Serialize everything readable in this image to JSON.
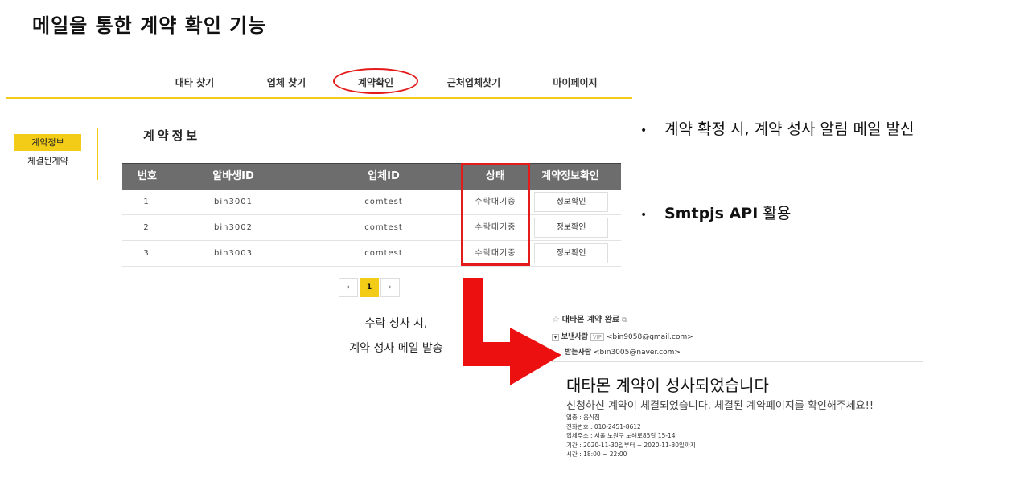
{
  "slide_title": "메일을 통한 계약 확인 기능",
  "nav": [
    {
      "label": "대타 찾기"
    },
    {
      "label": "업체 찾기"
    },
    {
      "label": "계약확인"
    },
    {
      "label": "근처업체찾기"
    },
    {
      "label": "마이페이지"
    }
  ],
  "sidebar": {
    "active": "계약정보",
    "item": "체결된계약"
  },
  "section_title": "계약정보",
  "table": {
    "headers": [
      "번호",
      "알바생ID",
      "업체ID",
      "상태",
      "계약정보확인"
    ],
    "rows": [
      {
        "no": "1",
        "worker": "bin3001",
        "company": "comtest",
        "status": "수락대기중",
        "action": "정보확인"
      },
      {
        "no": "2",
        "worker": "bin3002",
        "company": "comtest",
        "status": "수락대기중",
        "action": "정보확인"
      },
      {
        "no": "3",
        "worker": "bin3003",
        "company": "comtest",
        "status": "수락대기중",
        "action": "정보확인"
      }
    ]
  },
  "pagination": {
    "prev": "‹",
    "current": "1",
    "next": "›"
  },
  "bullets": [
    {
      "text": "계약 확정 시, 계약 성사 알림 메일 발신"
    },
    {
      "strong": "Smtpjs API",
      "rest": " 활용"
    }
  ],
  "bullet_marker": "•",
  "caption": [
    "수락 성사 시,",
    "계약 성사 메일 발송"
  ],
  "email": {
    "star": "☆",
    "subject": "대타몬 계약 완료",
    "sender_label": "보낸사람",
    "sender_badge": "VIP",
    "sender": "<bin9058@gmail.com>",
    "receiver_label": "받는사람",
    "receiver": "<bin3005@naver.com>",
    "title": "대타몬 계약이 성사되었습니다",
    "body": "신청하신 계약이 체결되었습니다. 체결된 계약페이지를 확인해주세요!!",
    "details": [
      "업종 : 음식점",
      "전화번호 : 010-2451-8612",
      "업체주소 : 서울 노원구 노해로85길 15-14",
      "기간 : 2020-11-30일부터 ~ 2020-11-30일까지",
      "시간 : 18:00 ~ 22:00"
    ]
  },
  "colors": {
    "accent": "#f3cc17",
    "highlight": "#e41b1b",
    "header_bg": "#6d6d6d"
  }
}
